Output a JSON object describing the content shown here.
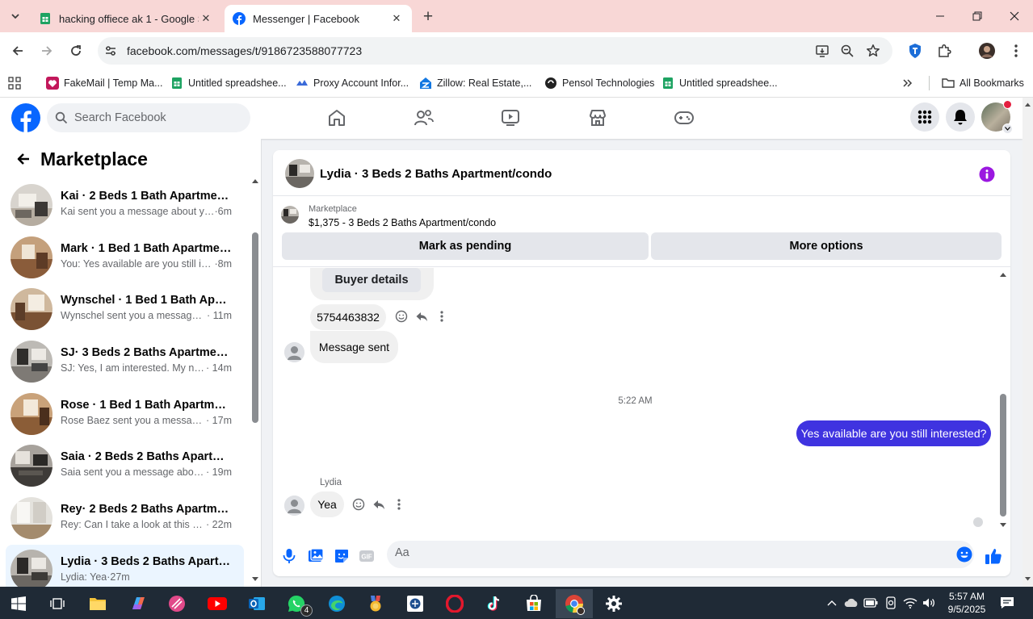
{
  "browser": {
    "tabs": [
      {
        "title": "hacking offiece ak 1 - Google S",
        "active": false
      },
      {
        "title": "Messenger | Facebook",
        "active": true
      }
    ],
    "url": "facebook.com/messages/t/9186723588077723",
    "bookmarks": [
      {
        "label": "FakeMail | Temp Ma..."
      },
      {
        "label": "Untitled spreadshee..."
      },
      {
        "label": "Proxy Account Infor..."
      },
      {
        "label": "Zillow: Real Estate,..."
      },
      {
        "label": "Pensol Technologies"
      },
      {
        "label": "Untitled spreadshee..."
      }
    ],
    "all_bookmarks": "All Bookmarks"
  },
  "facebook": {
    "search_placeholder": "Search Facebook",
    "brand_color": "#0866ff"
  },
  "marketplace": {
    "title": "Marketplace",
    "conversations": [
      {
        "name": "Kai · 2 Beds 1 Bath Apartment/c...",
        "preview": "Kai sent you a message about you...",
        "time": " ·6m"
      },
      {
        "name": "Mark · 1 Bed 1 Bath Apartment/...",
        "preview": "You: Yes available are you still inter...",
        "time": " ·8m"
      },
      {
        "name": "Wynschel · 1 Bed 1 Bath Apartm...",
        "preview": "Wynschel sent you a message ab...",
        "time": " · 11m"
      },
      {
        "name": "SJ· 3 Beds 2 Baths Apartment/c...",
        "preview": "SJ: Yes, I am interested. My numb...",
        "time": " · 14m"
      },
      {
        "name": "Rose · 1 Bed 1 Bath Apartment/c...",
        "preview": "Rose Baez sent you a message a...",
        "time": " · 17m"
      },
      {
        "name": "Saia · 2 Beds 2 Baths Apartment...",
        "preview": "Saia sent you a message about y...",
        "time": " · 19m"
      },
      {
        "name": "Rey· 2 Beds 2 Baths Apartment/...",
        "preview": "Rey: Can I take a look at this pro...",
        "time": " · 22m"
      },
      {
        "name": "Lydia · 3 Beds 2 Baths Apartmen...",
        "preview": "Lydia: Yea",
        "time": " ·27m",
        "active": true
      }
    ]
  },
  "chat": {
    "title": "Lydia · 3 Beds 2 Baths Apartment/condo",
    "listing_label": "Marketplace",
    "listing": "$1,375 - 3 Beds 2 Baths Apartment/condo",
    "mark_pending": "Mark as pending",
    "more_options": "More options",
    "buyer_details": "Buyer details",
    "phone_message": "5754463832",
    "message_sent": "Message sent",
    "timestamp": "5:22 AM",
    "outgoing": "Yes available are you still  interested?",
    "sender": "Lydia",
    "reply": "Yea",
    "composer_placeholder": "Aa",
    "outgoing_color": "#3f33e0"
  },
  "taskbar": {
    "whatsapp_badge": "4",
    "time": "5:57 AM",
    "date": "9/5/2025"
  }
}
